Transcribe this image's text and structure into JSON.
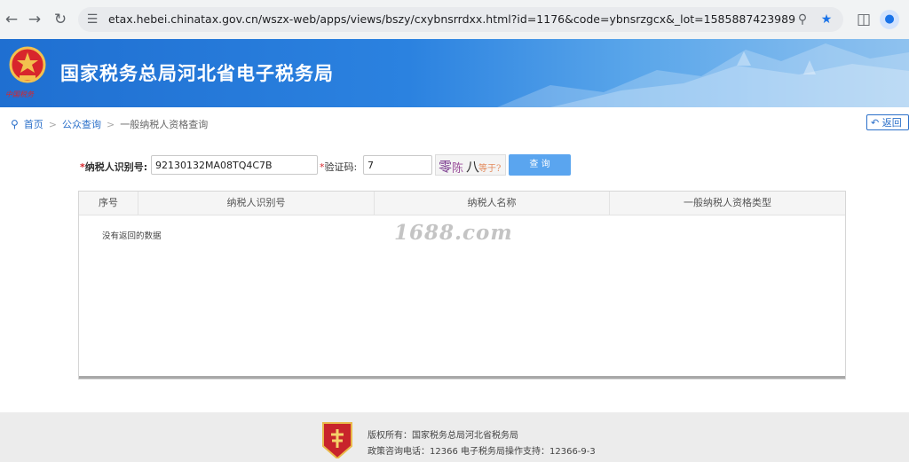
{
  "browser": {
    "url": "etax.hebei.chinatax.gov.cn/wszx-web/apps/views/bszy/cxybnsrrdxx.html?id=1176&code=ybnsrzgcx&_lot=1585887423989"
  },
  "header": {
    "site_title": "国家税务总局河北省电子税务局"
  },
  "breadcrumb": {
    "home": "首页",
    "public_query": "公众查询",
    "current": "一般纳税人资格查询"
  },
  "back_button": "返回",
  "form": {
    "taxpayer_id_label": "纳税人识别号:",
    "taxpayer_id_value": "92130132MA08TQ4C7B",
    "captcha_label": "验证码:",
    "captcha_value": "7",
    "captcha_chars": [
      "零",
      "陈",
      "八",
      "等于?"
    ],
    "query_button": "查 询"
  },
  "table": {
    "columns": [
      "序号",
      "纳税人识别号",
      "纳税人名称",
      "一般纳税人资格类型"
    ],
    "empty_message": "没有返回的数据"
  },
  "watermark": "1688.com",
  "footer": {
    "copyright": "版权所有：国家税务总局河北省税务局",
    "contact": "政策咨询电话：12366 电子税务局操作支持：12366-9-3"
  },
  "colors": {
    "banner_start": "#1f6fd1",
    "banner_end": "#8fc2ef",
    "link": "#2a6fc9",
    "query_button": "#5aa5ef",
    "required_mark": "#d8262c"
  }
}
